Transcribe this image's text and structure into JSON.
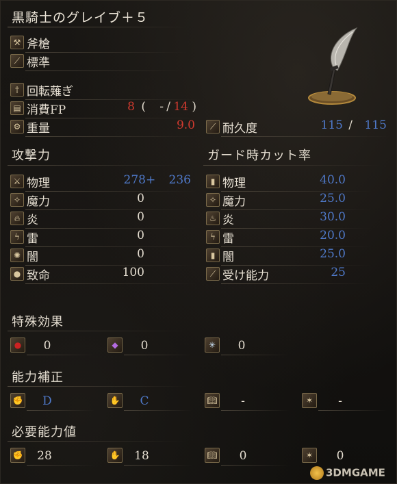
{
  "title": "黒騎士のグレイブ＋５",
  "weapon": {
    "type_label": "斧槍",
    "affinity_label": "標準",
    "skill_label": "回転薙ぎ",
    "fp_label": "消費FP",
    "fp_cost": "8",
    "fp_open": "(",
    "fp_dash": "-",
    "fp_slash": "/",
    "fp_current": "14",
    "fp_close": ")",
    "weight_label": "重量",
    "weight": "9.0",
    "durability_label": "耐久度",
    "durability_current": "115",
    "durability_sep": "/",
    "durability_max": "115"
  },
  "attack": {
    "heading": "攻撃力",
    "rows": [
      {
        "label": "物理",
        "value": "278",
        "plus": "+",
        "bonus": "236"
      },
      {
        "label": "魔力",
        "value": "0"
      },
      {
        "label": "炎",
        "value": "0"
      },
      {
        "label": "雷",
        "value": "0"
      },
      {
        "label": "闇",
        "value": "0"
      },
      {
        "label": "致命",
        "value": "100"
      }
    ]
  },
  "guard": {
    "heading": "ガード時カット率",
    "rows": [
      {
        "label": "物理",
        "value": "40.0"
      },
      {
        "label": "魔力",
        "value": "25.0"
      },
      {
        "label": "炎",
        "value": "30.0"
      },
      {
        "label": "雷",
        "value": "20.0"
      },
      {
        "label": "闇",
        "value": "25.0"
      },
      {
        "label": "受け能力",
        "value": "25"
      }
    ]
  },
  "special": {
    "heading": "特殊効果",
    "values": [
      "0",
      "0",
      "0"
    ]
  },
  "scaling": {
    "heading": "能力補正",
    "values": [
      "D",
      "C",
      "-",
      "-"
    ]
  },
  "requirements": {
    "heading": "必要能力値",
    "values": [
      "28",
      "18",
      "0",
      "0"
    ]
  },
  "watermark": "3DMGAME"
}
